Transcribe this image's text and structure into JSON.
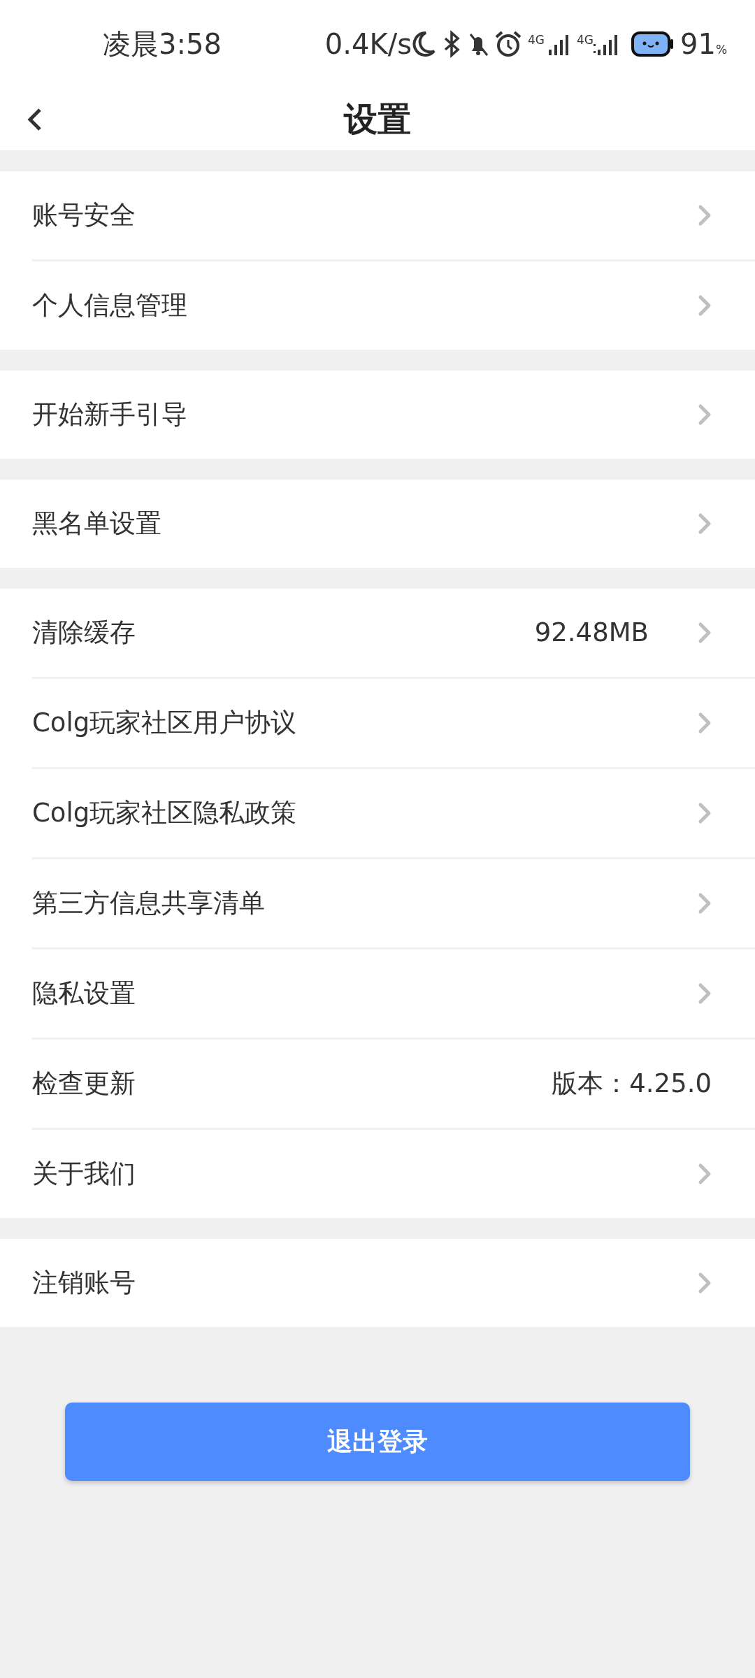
{
  "status_bar": {
    "time": "凌晨3:58",
    "speed": "0.4K/s",
    "network_1": "4G",
    "network_2": "4G",
    "battery": "91",
    "battery_unit": "%"
  },
  "header": {
    "title": "设置"
  },
  "groups": [
    {
      "rows": [
        {
          "label": "账号安全",
          "arrow": true
        },
        {
          "label": "个人信息管理",
          "arrow": true
        }
      ]
    },
    {
      "rows": [
        {
          "label": "开始新手引导",
          "arrow": true
        }
      ]
    },
    {
      "rows": [
        {
          "label": "黑名单设置",
          "arrow": true
        }
      ]
    },
    {
      "rows": [
        {
          "label": "清除缓存",
          "value": "92.48MB",
          "arrow": true
        },
        {
          "label": "Colg玩家社区用户协议",
          "arrow": true
        },
        {
          "label": "Colg玩家社区隐私政策",
          "arrow": true
        },
        {
          "label": "第三方信息共享清单",
          "arrow": true
        },
        {
          "label": "隐私设置",
          "arrow": true
        },
        {
          "label": "检查更新",
          "value": "版本：4.25.0",
          "arrow": false
        },
        {
          "label": "关于我们",
          "arrow": true
        }
      ]
    },
    {
      "rows": [
        {
          "label": "注销账号",
          "arrow": true
        }
      ]
    }
  ],
  "logout_button": "退出登录"
}
